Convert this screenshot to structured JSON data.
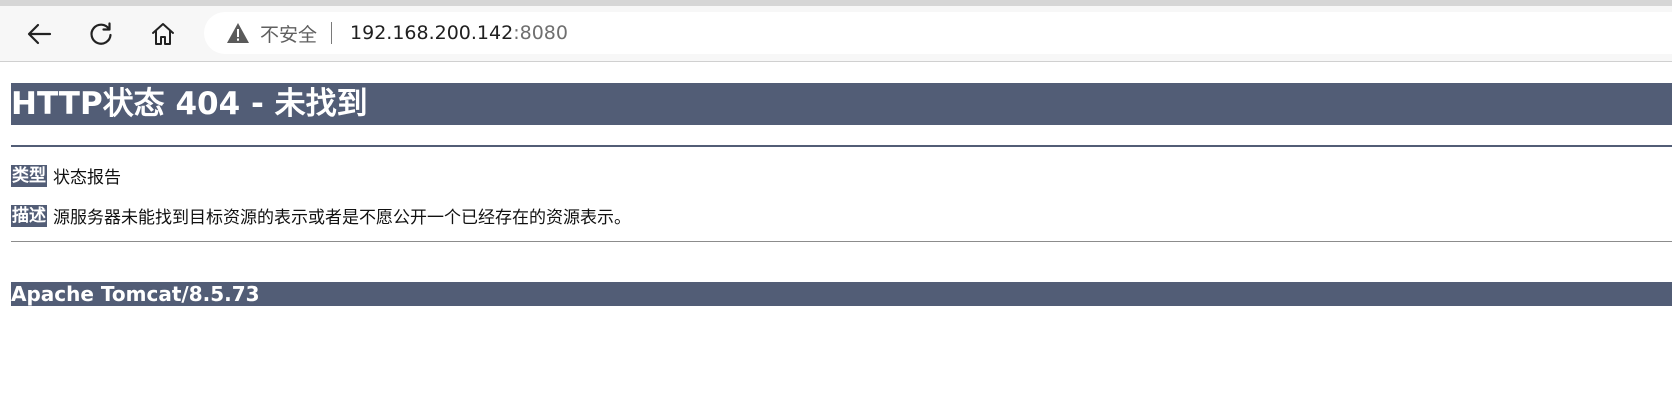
{
  "browser": {
    "security_label": "不安全",
    "url_host": "192.168.200.142",
    "url_port": ":8080"
  },
  "page": {
    "title": "HTTP状态 404 - 未找到",
    "type_label": "类型",
    "type_value": "状态报告",
    "desc_label": "描述",
    "desc_value": "源服务器未能找到目标资源的表示或者是不愿公开一个已经存在的资源表示。",
    "footer": "Apache Tomcat/8.5.73"
  },
  "colors": {
    "tomcat_header": "#525d76",
    "toolbar_bg": "#f7f7f7"
  },
  "icons": [
    "back-arrow-icon",
    "reload-icon",
    "home-icon",
    "warning-triangle-icon"
  ]
}
